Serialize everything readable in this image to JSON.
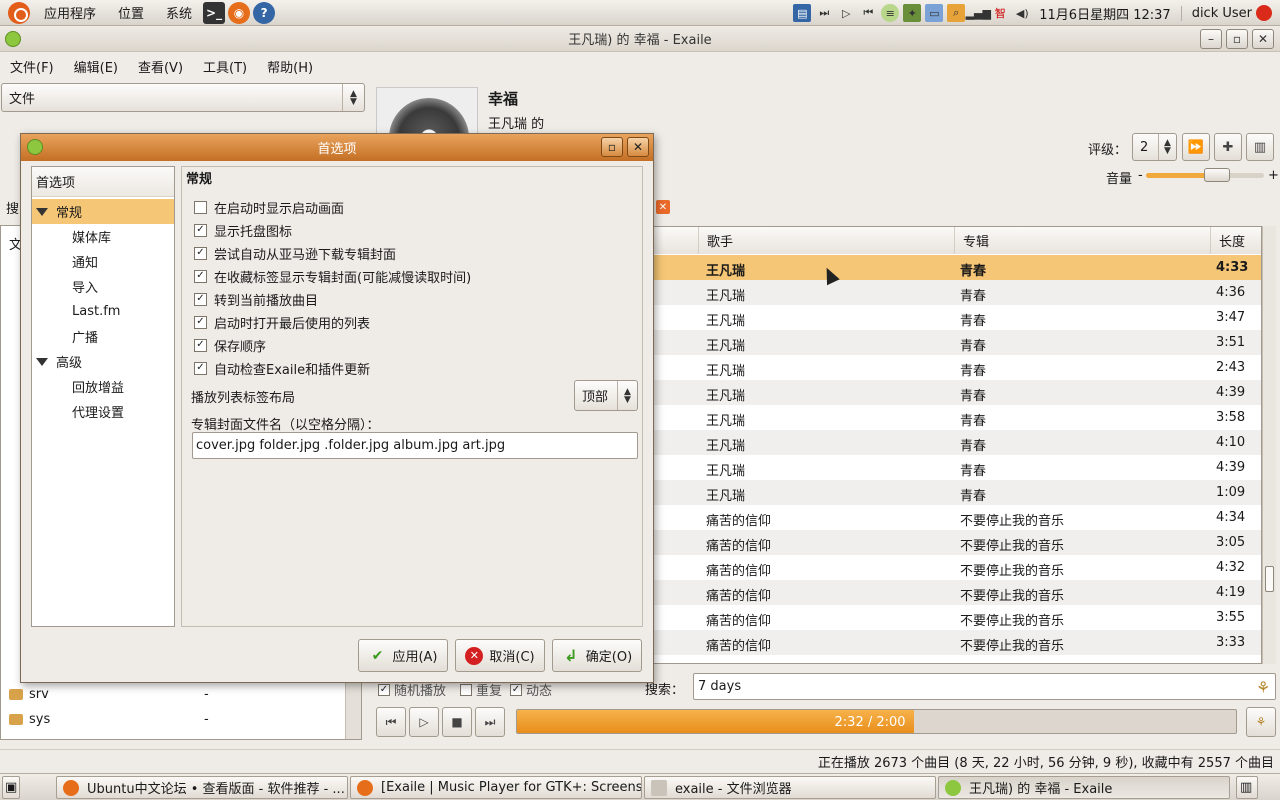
{
  "top_panel": {
    "menus": [
      "应用程序",
      "位置",
      "系统"
    ],
    "clock": "11月6日星期四 12:37",
    "user": "dick User"
  },
  "window": {
    "title": "王凡瑞) 的 幸福 - Exaile"
  },
  "menubar": [
    "文件(F)",
    "编辑(E)",
    "查看(V)",
    "工具(T)",
    "帮助(H)"
  ],
  "panel_selector": "文件",
  "now_playing": {
    "title": "幸福",
    "artist": "王凡瑞 的"
  },
  "rating": {
    "label": "评级：",
    "value": "2"
  },
  "volume": {
    "label": "音量",
    "minus": "-",
    "plus": "+",
    "level": 0.6
  },
  "file_browser": {
    "search_label": "搜",
    "header": "文",
    "bottom_rows": [
      {
        "name": "srv",
        "size": "-"
      },
      {
        "name": "sys",
        "size": "-"
      }
    ]
  },
  "playlist": {
    "columns": [
      "歌手",
      "专辑",
      "长度"
    ],
    "rows": [
      {
        "artist": "王凡瑞",
        "album": "青春",
        "length": "4:33"
      },
      {
        "artist": "王凡瑞",
        "album": "青春",
        "length": "4:36"
      },
      {
        "artist": "王凡瑞",
        "album": "青春",
        "length": "3:47"
      },
      {
        "artist": "王凡瑞",
        "album": "青春",
        "length": "3:51"
      },
      {
        "artist": "王凡瑞",
        "album": "青春",
        "length": "2:43"
      },
      {
        "artist": "王凡瑞",
        "album": "青春",
        "length": "4:39"
      },
      {
        "artist": "王凡瑞",
        "album": "青春",
        "length": "3:58"
      },
      {
        "artist": "王凡瑞",
        "album": "青春",
        "length": "4:10"
      },
      {
        "artist": "王凡瑞",
        "album": "青春",
        "length": "4:39"
      },
      {
        "artist": "王凡瑞",
        "album": "青春",
        "length": "1:09"
      },
      {
        "artist": "痛苦的信仰",
        "album": "不要停止我的音乐",
        "length": "4:34"
      },
      {
        "artist": "痛苦的信仰",
        "album": "不要停止我的音乐",
        "length": "3:05"
      },
      {
        "artist": "痛苦的信仰",
        "album": "不要停止我的音乐",
        "length": "4:32"
      },
      {
        "artist": "痛苦的信仰",
        "album": "不要停止我的音乐",
        "length": "4:19"
      },
      {
        "artist": "痛苦的信仰",
        "album": "不要停止我的音乐",
        "length": "3:55"
      },
      {
        "artist": "痛苦的信仰",
        "album": "不要停止我的音乐",
        "length": "3:33"
      }
    ]
  },
  "bottom": {
    "shuffle": "随机播放",
    "repeat": "重复",
    "dynamic": "动态",
    "search_label": "搜索：",
    "search_value": "7 days",
    "progress_text": "2:32 / 2:00",
    "progress": 0.55
  },
  "statusbar": "正在播放 2673 个曲目 (8 天, 22 小时, 56 分钟, 9 秒), 收藏中有 2557 个曲目",
  "taskbar": [
    {
      "label": "Ubuntu中文论坛 • 查看版面 - 软件推荐 - ..."
    },
    {
      "label": "[Exaile | Music Player for GTK+: Screensh..."
    },
    {
      "label": "exaile - 文件浏览器"
    },
    {
      "label": "王凡瑞) 的 幸福 - Exaile"
    }
  ],
  "prefs": {
    "title": "首选项",
    "nav_header": "首选项",
    "nav": [
      {
        "label": "常规",
        "level": 0,
        "expanded": true,
        "selected": true
      },
      {
        "label": "媒体库",
        "level": 1
      },
      {
        "label": "通知",
        "level": 1
      },
      {
        "label": "导入",
        "level": 1
      },
      {
        "label": "Last.fm",
        "level": 1
      },
      {
        "label": "广播",
        "level": 1
      },
      {
        "label": "高级",
        "level": 0,
        "expanded": true
      },
      {
        "label": "回放增益",
        "level": 1
      },
      {
        "label": "代理设置",
        "level": 1
      }
    ],
    "section": "常规",
    "options": [
      {
        "label": "在启动时显示启动画面",
        "checked": false
      },
      {
        "label": "显示托盘图标",
        "checked": true
      },
      {
        "label": "尝试自动从亚马逊下载专辑封面",
        "checked": true
      },
      {
        "label": "在收藏标签显示专辑封面(可能减慢读取时间)",
        "checked": true
      },
      {
        "label": "转到当前播放曲目",
        "checked": true
      },
      {
        "label": "启动时打开最后使用的列表",
        "checked": true
      },
      {
        "label": "保存顺序",
        "checked": true
      },
      {
        "label": "自动检查Exaile和插件更新",
        "checked": true
      }
    ],
    "tab_layout_label": "播放列表标签布局",
    "tab_layout_value": "顶部",
    "cover_names_label": "专辑封面文件名（以空格分隔）：",
    "cover_names_value": "cover.jpg folder.jpg .folder.jpg album.jpg art.jpg",
    "buttons": {
      "apply": "应用(A)",
      "cancel": "取消(C)",
      "ok": "确定(O)"
    }
  }
}
